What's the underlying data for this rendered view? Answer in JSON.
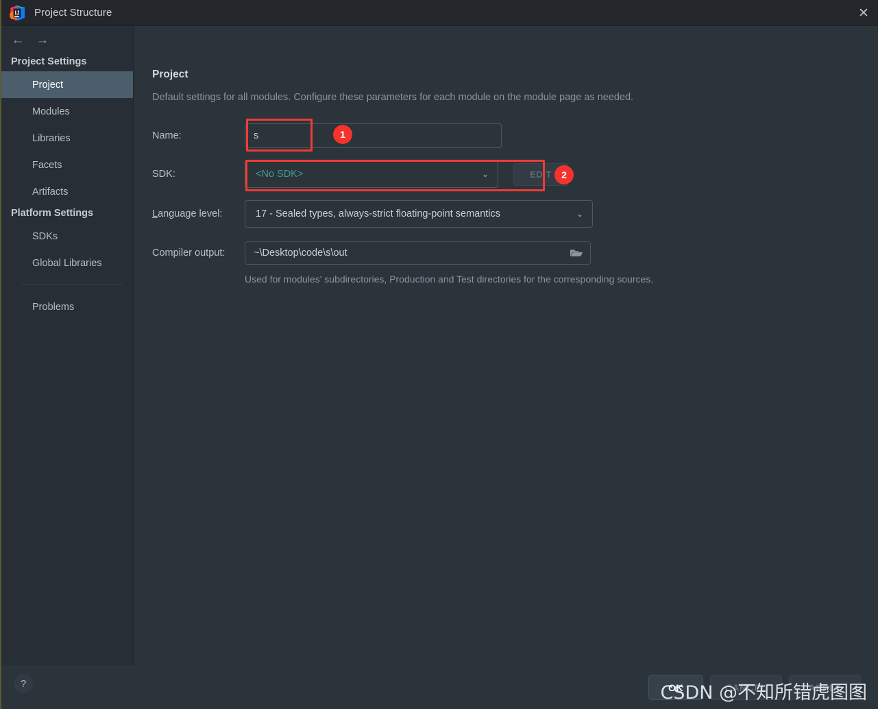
{
  "window": {
    "title": "Project Structure",
    "logo_icon": "intellij-idea-logo",
    "close_icon": "✕"
  },
  "nav": {
    "back_icon": "←",
    "forward_icon": "→"
  },
  "sidebar": {
    "groups": [
      {
        "header": "Project Settings",
        "items": [
          {
            "label": "Project",
            "selected": true
          },
          {
            "label": "Modules",
            "selected": false
          },
          {
            "label": "Libraries",
            "selected": false
          },
          {
            "label": "Facets",
            "selected": false
          },
          {
            "label": "Artifacts",
            "selected": false
          }
        ]
      },
      {
        "header": "Platform Settings",
        "items": [
          {
            "label": "SDKs",
            "selected": false
          },
          {
            "label": "Global Libraries",
            "selected": false
          }
        ]
      }
    ],
    "problems": {
      "label": "Problems"
    }
  },
  "main": {
    "section_title": "Project",
    "section_desc": "Default settings for all modules. Configure these parameters for each module on the module page as needed.",
    "fields": {
      "name": {
        "label": "Name:",
        "value": "s"
      },
      "sdk": {
        "label": "SDK:",
        "value": "<No SDK>",
        "value_color": "#3f9e8c",
        "chevron_icon": "⌄",
        "edit_button": "EDIT"
      },
      "language_level": {
        "label_mnemonic": "L",
        "label_rest": "anguage level:",
        "value": "17 - Sealed types, always-strict floating-point semantics",
        "chevron_icon": "⌄"
      },
      "compiler_output": {
        "label": "Compiler output:",
        "value": "~\\Desktop\\code\\s\\out",
        "browse_icon": "folder-icon",
        "hint": "Used for modules' subdirectories, Production and Test directories for the corresponding sources."
      }
    }
  },
  "annotations": {
    "accent_color": "#f5332c",
    "badges": [
      {
        "number": "1",
        "target": "sdk-value"
      },
      {
        "number": "2",
        "target": "language-level-chevron"
      }
    ]
  },
  "footer": {
    "help_icon": "?",
    "ok_label": "OK",
    "cancel_label": "CANCEL",
    "apply_label": "APPLY"
  },
  "watermark": {
    "text": "CSDN @不知所错虎图图"
  }
}
